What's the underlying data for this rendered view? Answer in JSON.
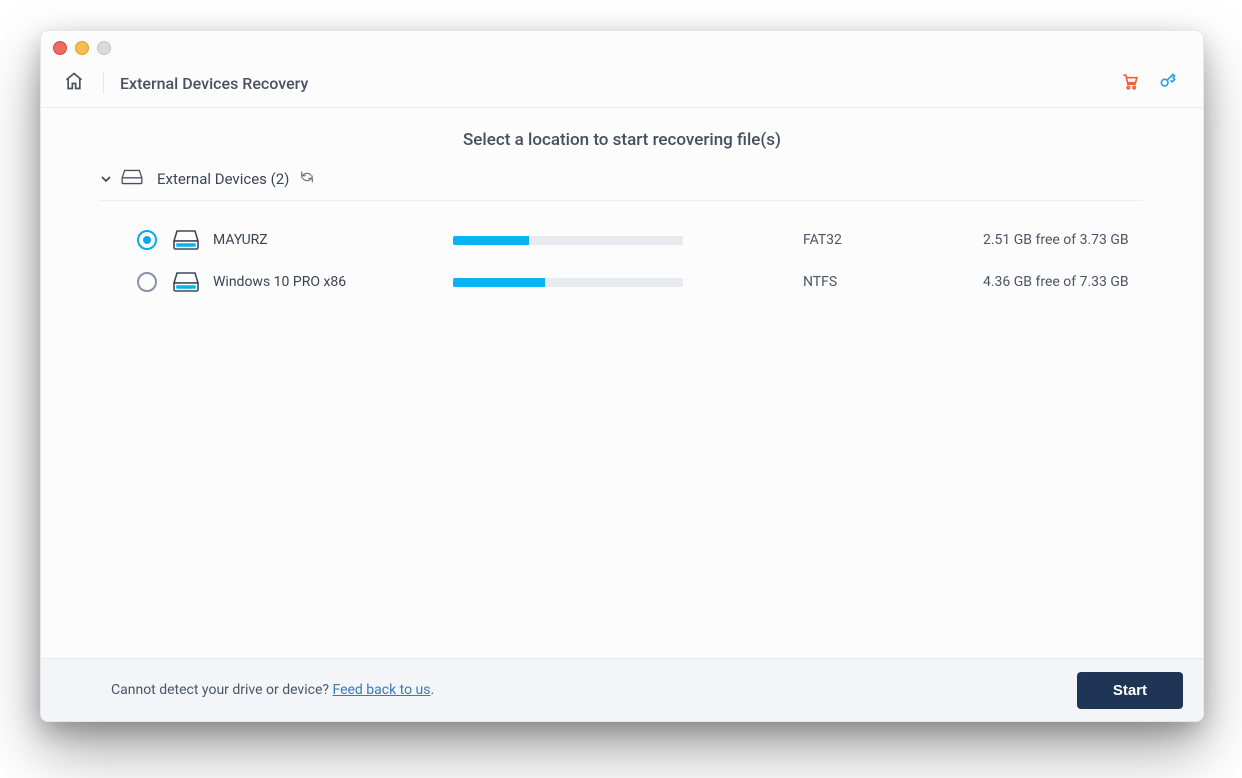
{
  "header": {
    "title": "External Devices Recovery"
  },
  "prompt": "Select a location to start recovering file(s)",
  "group": {
    "label": "External Devices (2)"
  },
  "devices": [
    {
      "name": "MAYURZ",
      "filesystem": "FAT32",
      "space_text": "2.51 GB free of 3.73 GB",
      "used_percent": 33,
      "selected": true
    },
    {
      "name": "Windows 10 PRO x86",
      "filesystem": "NTFS",
      "space_text": "4.36 GB free of 7.33 GB",
      "used_percent": 40,
      "selected": false
    }
  ],
  "footer": {
    "question": "Cannot detect your drive or device? ",
    "link_text": "Feed back to us",
    "period": ".",
    "start_label": "Start"
  }
}
